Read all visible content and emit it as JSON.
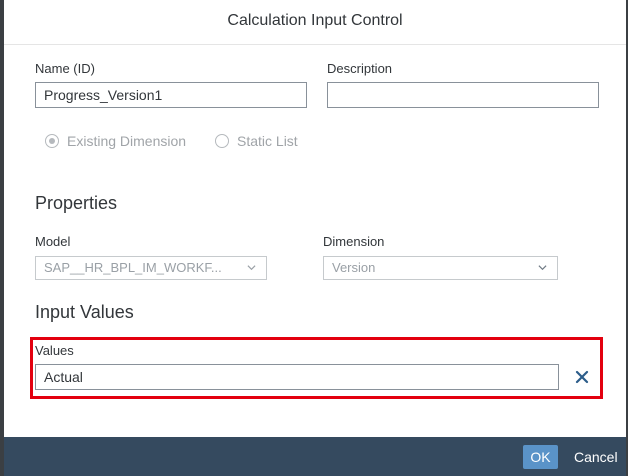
{
  "dialog": {
    "title": "Calculation Input Control",
    "name_label": "Name (ID)",
    "name_value": "Progress_Version1",
    "description_label": "Description",
    "description_value": "",
    "radio_existing_label": "Existing Dimension",
    "radio_static_label": "Static List",
    "properties_title": "Properties",
    "model_label": "Model",
    "model_value": "SAP__HR_BPL_IM_WORKF...",
    "dimension_label": "Dimension",
    "dimension_value": "Version",
    "input_values_title": "Input Values",
    "values_label": "Values",
    "values_value": "Actual",
    "ok_label": "OK",
    "cancel_label": "Cancel"
  },
  "colors": {
    "footer_bg": "#354a5f",
    "ok_bg": "#5a93c8",
    "highlight": "#e3000f"
  },
  "icons": {
    "clear": "close-icon",
    "dropdown": "chevron-down-icon",
    "radio_selected": "radio-selected-icon",
    "radio_unselected": "radio-unselected-icon"
  }
}
